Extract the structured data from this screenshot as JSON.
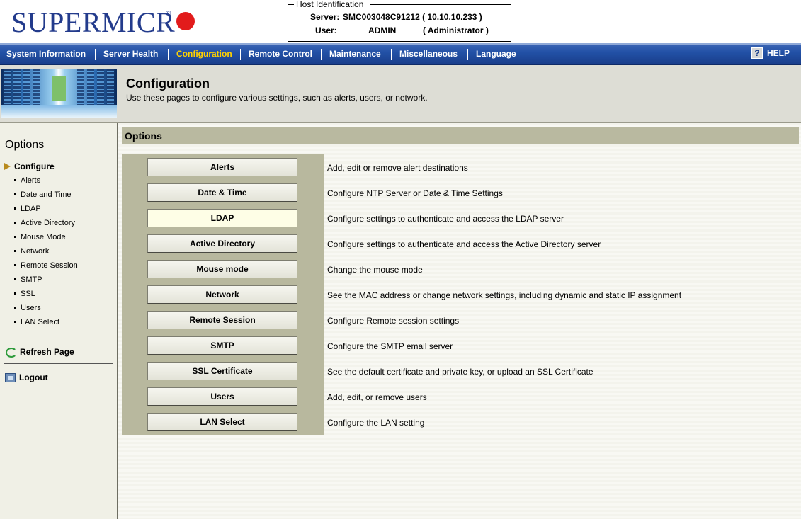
{
  "header": {
    "logo_text": "SUPERMICR",
    "logo_reg": "®",
    "host_legend": "Host Identification",
    "server_label": "Server:",
    "server_value": "SMC003048C91212 (  10.10.10.233  )",
    "user_label": "User:",
    "user_value": "ADMIN",
    "user_role": "( Administrator )"
  },
  "nav": {
    "items": [
      {
        "label": "System Information"
      },
      {
        "label": "Server Health"
      },
      {
        "label": "Configuration"
      },
      {
        "label": "Remote Control"
      },
      {
        "label": "Maintenance"
      },
      {
        "label": "Miscellaneous"
      },
      {
        "label": "Language"
      }
    ],
    "active": "Configuration",
    "help_label": "HELP",
    "help_icon": "?"
  },
  "banner": {
    "title": "Configuration",
    "subtitle": "Use these pages to configure various settings, such as alerts, users, or network."
  },
  "sidebar": {
    "title": "Options",
    "section": "Configure",
    "items": [
      {
        "label": "Alerts"
      },
      {
        "label": "Date and Time"
      },
      {
        "label": "LDAP"
      },
      {
        "label": "Active Directory"
      },
      {
        "label": "Mouse Mode"
      },
      {
        "label": "Network"
      },
      {
        "label": "Remote Session"
      },
      {
        "label": "SMTP"
      },
      {
        "label": "SSL"
      },
      {
        "label": "Users"
      },
      {
        "label": "LAN Select"
      }
    ],
    "refresh_label": "Refresh Page",
    "logout_label": "Logout"
  },
  "main": {
    "header": "Options",
    "options": [
      {
        "button": "Alerts",
        "description": "Add, edit or remove alert destinations"
      },
      {
        "button": "Date & Time",
        "description": "Configure NTP Server or Date & Time Settings"
      },
      {
        "button": "LDAP",
        "description": "Configure settings to authenticate and access the LDAP server"
      },
      {
        "button": "Active Directory",
        "description": "Configure settings to authenticate and access the Active Directory server"
      },
      {
        "button": "Mouse mode",
        "description": "Change the mouse mode"
      },
      {
        "button": "Network",
        "description": "See the MAC address or change network settings, including dynamic and static IP assignment"
      },
      {
        "button": "Remote Session",
        "description": "Configure Remote session settings"
      },
      {
        "button": "SMTP",
        "description": "Configure the SMTP email server"
      },
      {
        "button": "SSL Certificate",
        "description": "See the default certificate and private key, or upload an SSL Certificate"
      },
      {
        "button": "Users",
        "description": "Add, edit, or remove users"
      },
      {
        "button": "LAN Select",
        "description": "Configure the LAN setting"
      }
    ]
  },
  "colors": {
    "brand_blue": "#233b8c",
    "nav_blue": "#2251a6",
    "active_nav": "#ffd200",
    "logo_red": "#e21b1b",
    "panel": "#b8b89e"
  }
}
